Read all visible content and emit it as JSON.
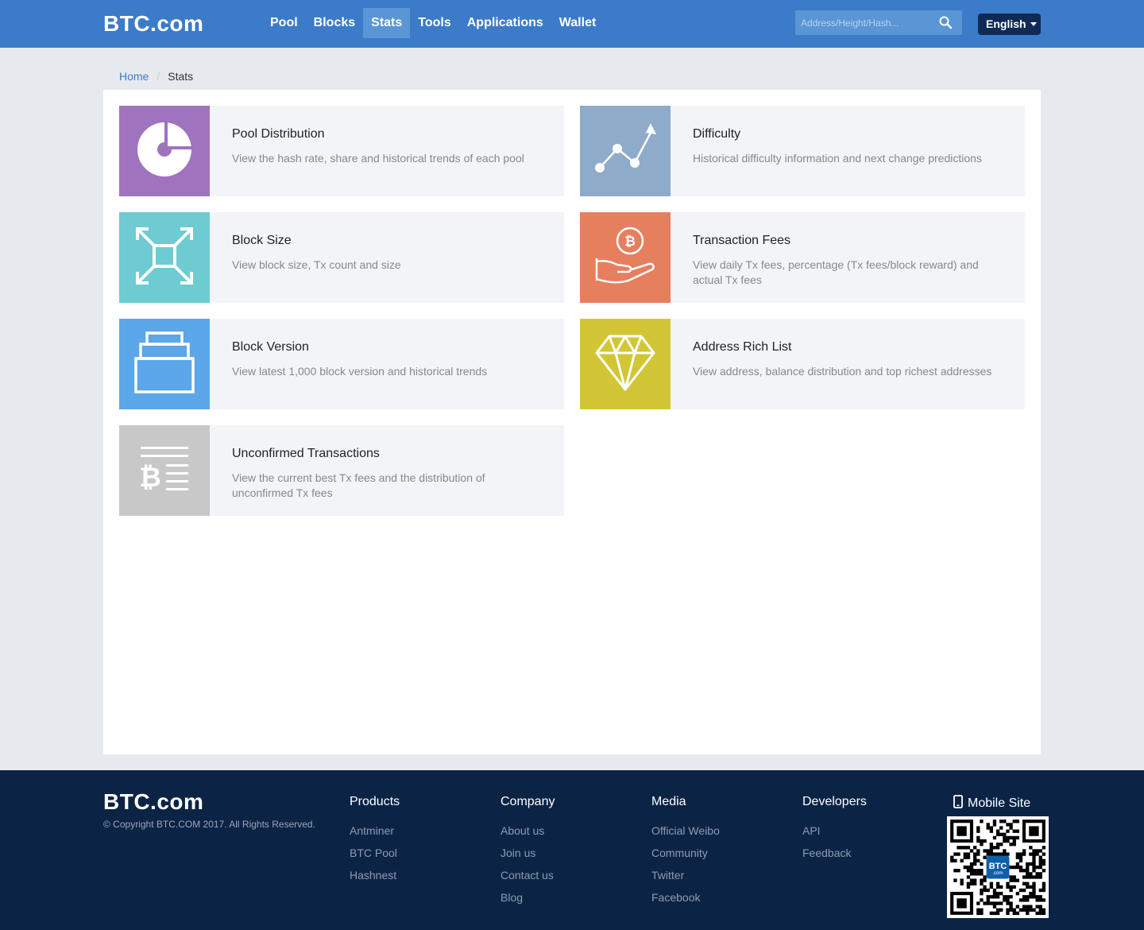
{
  "header": {
    "logo": "BTC.com",
    "nav": [
      {
        "label": "Pool",
        "active": false
      },
      {
        "label": "Blocks",
        "active": false
      },
      {
        "label": "Stats",
        "active": true
      },
      {
        "label": "Tools",
        "active": false
      },
      {
        "label": "Applications",
        "active": false
      },
      {
        "label": "Wallet",
        "active": false
      }
    ],
    "search_placeholder": "Address/Height/Hash...",
    "language": "English"
  },
  "breadcrumb": {
    "home": "Home",
    "current": "Stats"
  },
  "cards": [
    {
      "title": "Pool Distribution",
      "desc": "View the hash rate,  share and historical trends of each pool",
      "color": "#a073bf",
      "icon": "pie-chart-icon"
    },
    {
      "title": "Difficulty",
      "desc": "Historical difficulty information and next change predictions",
      "color": "#8eabc9",
      "icon": "trend-line-icon"
    },
    {
      "title": "Block Size",
      "desc": "View block size,  Tx count and size",
      "color": "#6ecbd2",
      "icon": "expand-arrows-icon"
    },
    {
      "title": "Transaction Fees",
      "desc": "View daily Tx fees,  percentage (Tx fees/block reward) and actual Tx fees",
      "color": "#e57f5e",
      "icon": "bitcoin-hand-icon"
    },
    {
      "title": "Block Version",
      "desc": "View latest 1,000 block version and historical trends",
      "color": "#5ba7ea",
      "icon": "stacked-blocks-icon"
    },
    {
      "title": "Address Rich List",
      "desc": "View address,  balance distribution and top richest addresses",
      "color": "#d2c637",
      "icon": "diamond-icon"
    },
    {
      "title": "Unconfirmed Transactions",
      "desc": "View the current best Tx fees and the distribution of unconfirmed Tx fees",
      "color": "#c8c8c8",
      "icon": "bitcoin-list-icon"
    }
  ],
  "footer": {
    "logo": "BTC.com",
    "copyright": "© Copyright BTC.COM 2017. All Rights Reserved.",
    "columns": [
      {
        "title": "Products",
        "links": [
          "Antminer",
          "BTC Pool",
          "Hashnest"
        ]
      },
      {
        "title": "Company",
        "links": [
          "About us",
          "Join us",
          "Contact us",
          "Blog"
        ]
      },
      {
        "title": "Media",
        "links": [
          "Official Weibo",
          "Community",
          "Twitter",
          "Facebook"
        ]
      },
      {
        "title": "Developers",
        "links": [
          "API",
          "Feedback"
        ]
      }
    ],
    "mobile_site": "Mobile Site",
    "qr_badge": "BTC",
    "qr_badge_sub": ".com"
  }
}
